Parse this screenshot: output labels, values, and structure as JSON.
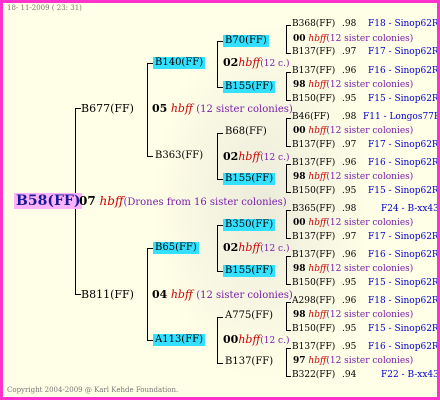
{
  "date": "18- 11-2009 ( 23: 31)",
  "footer": "Copyright 2004-2009 @ Karl Kehde Foundation.",
  "root": {
    "label": "B58(FF)",
    "num": "07",
    "hb": "hbff",
    "note": "(Drones from 16 sister colonies)"
  },
  "gen1": [
    {
      "label": "B677(FF)",
      "num": "05",
      "hb": "hbff",
      "note": "(12 sister colonies)"
    },
    {
      "label": "B811(FF)",
      "num": "04",
      "hb": "hbff",
      "note": "(12 sister colonies)"
    }
  ],
  "gen2": [
    {
      "label": "B140(FF)",
      "num": "02",
      "hb": "hbff",
      "note": "(12 c.)"
    },
    {
      "label": "B363(FF)",
      "num": "02",
      "hb": "hbff",
      "note": "(12 c.)"
    },
    {
      "label": "B65(FF)",
      "num": "02",
      "hb": "hbff",
      "note": "(12 c.)"
    },
    {
      "label": "A113(FF)",
      "num": "00",
      "hb": "hbff",
      "note": "(12 c.)"
    }
  ],
  "gen3": [
    {
      "label": "B70(FF)",
      "num": "00",
      "hb": "hbff",
      "note": "(12 sister colonies)"
    },
    {
      "label": "B155(FF)",
      "num": "98",
      "hb": "hbff",
      "note": "(12 sister colonies)"
    },
    {
      "label": "B68(FF)",
      "num": "00",
      "hb": "hbff",
      "note": "(12 sister colonies)"
    },
    {
      "label": "B155(FF)",
      "num": "98",
      "hb": "hbff",
      "note": "(12 sister colonies)"
    },
    {
      "label": "B350(FF)",
      "num": "00",
      "hb": "hbff",
      "note": "(12 sister colonies)"
    },
    {
      "label": "B155(FF)",
      "num": "98",
      "hb": "hbff",
      "note": "(12 sister colonies)"
    },
    {
      "label": "A775(FF)",
      "num": "98",
      "hb": "hbff",
      "note": "(12 sister colonies)"
    },
    {
      "label": "B137(FF)",
      "num": "97",
      "hb": "hbff",
      "note": "(12 sister colonies)"
    }
  ],
  "gen4": [
    {
      "label": "B368(FF)",
      "yr": ".98",
      "line": "F18 - Sinop62R"
    },
    {
      "label": "B137(FF)",
      "yr": ".97",
      "line": "F17 - Sinop62R"
    },
    {
      "label": "B137(FF)",
      "yr": ".96",
      "line": "F16 - Sinop62R"
    },
    {
      "label": "B150(FF)",
      "yr": ".95",
      "line": "F15 - Sinop62R"
    },
    {
      "label": "B46(FF)",
      "yr": ".98",
      "line": "F11 - Longos77R"
    },
    {
      "label": "B137(FF)",
      "yr": ".97",
      "line": "F17 - Sinop62R"
    },
    {
      "label": "B137(FF)",
      "yr": ".96",
      "line": "F16 - Sinop62R"
    },
    {
      "label": "B150(FF)",
      "yr": ".95",
      "line": "F15 - Sinop62R"
    },
    {
      "label": "B365(FF)",
      "yr": ".98",
      "line": "F24 - B-xx43"
    },
    {
      "label": "B137(FF)",
      "yr": ".97",
      "line": "F17 - Sinop62R"
    },
    {
      "label": "B137(FF)",
      "yr": ".96",
      "line": "F16 - Sinop62R"
    },
    {
      "label": "B150(FF)",
      "yr": ".95",
      "line": "F15 - Sinop62R"
    },
    {
      "label": "A298(FF)",
      "yr": ".96",
      "line": "F18 - Sinop62R"
    },
    {
      "label": "B150(FF)",
      "yr": ".95",
      "line": "F15 - Sinop62R"
    },
    {
      "label": "B137(FF)",
      "yr": ".95",
      "line": "F16 - Sinop62R"
    },
    {
      "label": "B322(FF)",
      "yr": ".94",
      "line": "F22 - B-xx43"
    }
  ]
}
